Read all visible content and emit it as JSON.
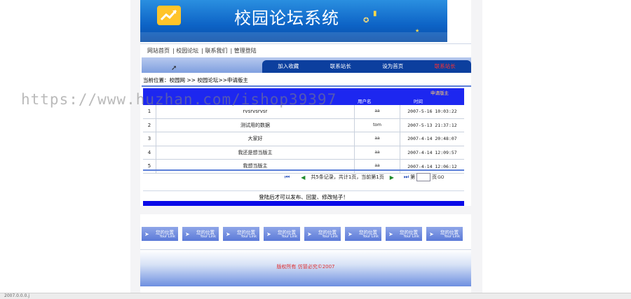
{
  "header": {
    "site_title": "校园论坛系统"
  },
  "top_nav": [
    "网站首页",
    "校园论坛",
    "联系我们",
    "管理登陆"
  ],
  "menu_tabs": [
    "加入收藏",
    "联系站长",
    "设为首页",
    "联系站长"
  ],
  "menu_highlight_color": "#ff3030",
  "breadcrumb": "当前位置：校园网 >> 校园论坛>>申请版主",
  "table": {
    "header_link": "申请版主",
    "columns": [
      "",
      "",
      "用户名",
      "时间"
    ],
    "rows": [
      {
        "n": "1",
        "title": "rvsrvsrvsr",
        "user": "aa",
        "date": "2007-5-16 10:03:22"
      },
      {
        "n": "2",
        "title": "测试用的数据",
        "user": "tom",
        "date": "2007-5-13 21:37:12"
      },
      {
        "n": "3",
        "title": "大家好",
        "user": "aa",
        "date": "2007-4-14 20:48:07"
      },
      {
        "n": "4",
        "title": "我还是想当版主",
        "user": "aa",
        "date": "2007-4-14 12:09:57"
      },
      {
        "n": "5",
        "title": "我想当版主",
        "user": "aa",
        "date": "2007-4-14 12:06:12"
      }
    ]
  },
  "pager": {
    "summary": "共5条记录，共计1页，当前第1页",
    "goto_prefix": "第",
    "goto_suffix": "页",
    "go_label": "GO"
  },
  "notice": "登陆后才可以发布、回复、修改帖子！",
  "links": [
    {
      "title": "您的位置",
      "sub": "Your Link"
    },
    {
      "title": "您的位置",
      "sub": "Your Link"
    },
    {
      "title": "您的位置",
      "sub": "Your Link"
    },
    {
      "title": "您的位置",
      "sub": "Your Link"
    },
    {
      "title": "您的位置",
      "sub": "Your Link"
    },
    {
      "title": "您的位置",
      "sub": "Your Link"
    },
    {
      "title": "您的位置",
      "sub": "Your Link"
    },
    {
      "title": "您的位置",
      "sub": "Your Link"
    }
  ],
  "copyright": "版权所有  仿冒必究©2007",
  "watermark": "https://www.huzhan.com/ishop39397",
  "status": "2007.0.0.0.j"
}
